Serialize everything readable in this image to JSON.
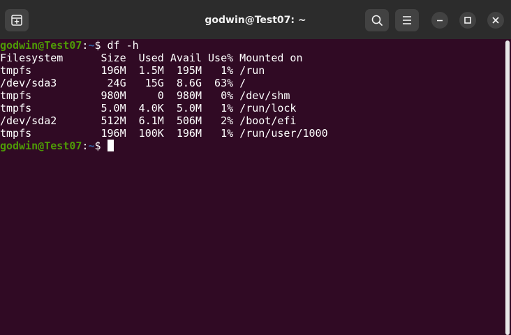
{
  "window": {
    "title": "godwin@Test07: ~"
  },
  "icons": {
    "new_tab": "new-tab-icon",
    "search": "search-icon",
    "menu": "hamburger-menu-icon",
    "minimize": "minimize-icon",
    "maximize": "maximize-icon",
    "close": "close-icon"
  },
  "colors": {
    "terminal_bg": "#300a24",
    "titlebar_bg": "#2c2c2c",
    "prompt_user": "#4e9a06",
    "prompt_path": "#3465a4",
    "text": "#ffffff"
  },
  "terminal": {
    "prompt_user": "godwin@Test07",
    "prompt_sep": ":",
    "prompt_path": "~",
    "prompt_symbol": "$ ",
    "command": "df -h",
    "output_header": "Filesystem      Size  Used Avail Use% Mounted on",
    "output_rows": [
      "tmpfs           196M  1.5M  195M   1% /run",
      "/dev/sda3        24G   15G  8.6G  63% /",
      "tmpfs           980M     0  980M   0% /dev/shm",
      "tmpfs           5.0M  4.0K  5.0M   1% /run/lock",
      "/dev/sda2       512M  6.1M  506M   2% /boot/efi",
      "tmpfs           196M  100K  196M   1% /run/user/1000"
    ]
  }
}
